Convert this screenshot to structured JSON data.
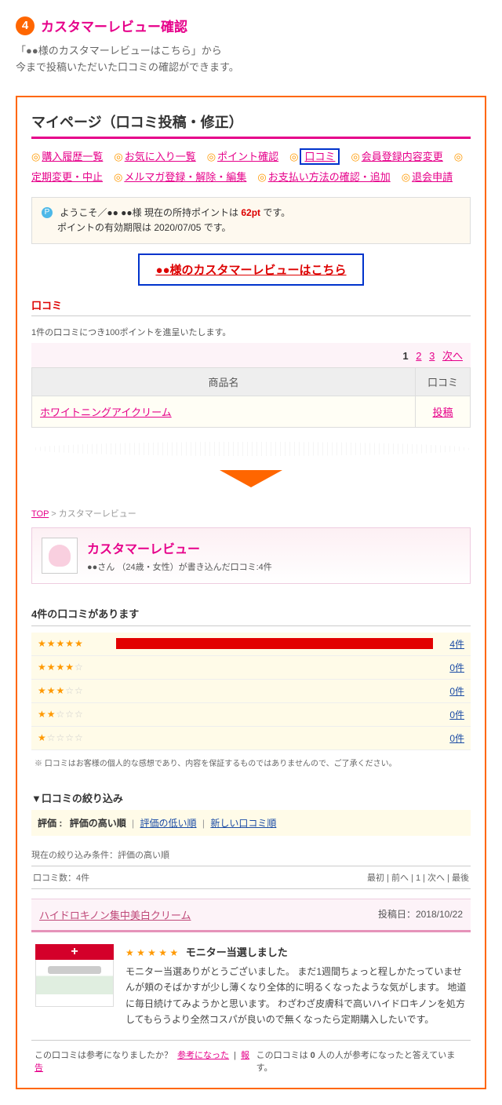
{
  "header": {
    "num": "4",
    "title": "カスタマーレビュー確認"
  },
  "intro": {
    "line1": "「●●様のカスタマーレビューはこちら」から",
    "line2": "今まで投稿いただいた口コミの確認ができます。"
  },
  "mypage": {
    "title": "マイページ（口コミ投稿・修正）",
    "nav": [
      {
        "label": "購入履歴一覧",
        "boxed": false
      },
      {
        "label": "お気に入り一覧",
        "boxed": false
      },
      {
        "label": "ポイント確認",
        "boxed": false
      },
      {
        "label": "口コミ",
        "boxed": true
      },
      {
        "label": "会員登録内容変更",
        "boxed": false
      },
      {
        "label": "定期変更・中止",
        "boxed": false
      },
      {
        "label": "メルマガ登録・解除・編集",
        "boxed": false
      },
      {
        "label": "お支払い方法の確認・追加",
        "boxed": false
      },
      {
        "label": "退会申請",
        "boxed": false
      }
    ],
    "points": {
      "pre": "ようこそ／●● ●●様 現在の所持ポイントは ",
      "pts": "62pt",
      "post": " です。",
      "expiry": "ポイントの有効期限は 2020/07/05 です。"
    },
    "customer_link": "●●様のカスタマーレビューはこちら",
    "subheading": "口コミ",
    "note": "1件の口コミにつき100ポイントを進呈いたします。",
    "pager": {
      "current": "1",
      "p2": "2",
      "p3": "3",
      "next": "次へ"
    },
    "table": {
      "col1": "商品名",
      "col2": "口コミ",
      "product": "ホワイトニングアイクリーム",
      "post": "投稿"
    }
  },
  "breadcrumb": {
    "top": "TOP",
    "sep": " > ",
    "current": "カスタマーレビュー"
  },
  "reviewhead": {
    "title": "カスタマーレビュー",
    "sub": "●●さん （24歳・女性）が書き込んだ口コミ:4件"
  },
  "summary": {
    "title": "4件の口コミがあります",
    "rows": [
      {
        "full": 5,
        "empty": 0,
        "pct": 100,
        "count": "4件"
      },
      {
        "full": 4,
        "empty": 1,
        "pct": 0,
        "count": "0件"
      },
      {
        "full": 3,
        "empty": 2,
        "pct": 0,
        "count": "0件"
      },
      {
        "full": 2,
        "empty": 3,
        "pct": 0,
        "count": "0件"
      },
      {
        "full": 1,
        "empty": 4,
        "pct": 0,
        "count": "0件"
      }
    ],
    "disclaimer": "※ 口コミはお客様の個人的な感想であり、内容を保証するものではありませんので、ご了承ください。"
  },
  "filter": {
    "heading": "▼口コミの絞り込み",
    "label": "評価  :",
    "opt1": "評価の高い順",
    "opt2": "評価の低い順",
    "opt3": "新しい口コミ順",
    "current": "現在の絞り込み条件：評価の高い順"
  },
  "listpager": {
    "left": "口コミ数：4件",
    "right": "最初 | 前へ | 1 | 次へ | 最後"
  },
  "review": {
    "product": "ハイドロキノン集中美白クリーム",
    "date": "投稿日：2018/10/22",
    "title": "モニター当選しました",
    "body": "モニター当選ありがとうございました。 まだ1週間ちょっと程しかたっていませんが頬のそばかすが少し薄くなり全体的に明るくなったような気がします。 地道に毎日続けてみようかと思います。 わざわざ皮膚科で高いハイドロキノンを処方してもらうより全然コスパが良いので無くなったら定期購入したいです。"
  },
  "footer": {
    "q": "この口コミは参考になりましたか？",
    "helpful": "参考になった",
    "report": "報告",
    "count_pre": "この口コミは ",
    "count_num": "0",
    "count_post": " 人の人が参考になったと答えています。"
  }
}
